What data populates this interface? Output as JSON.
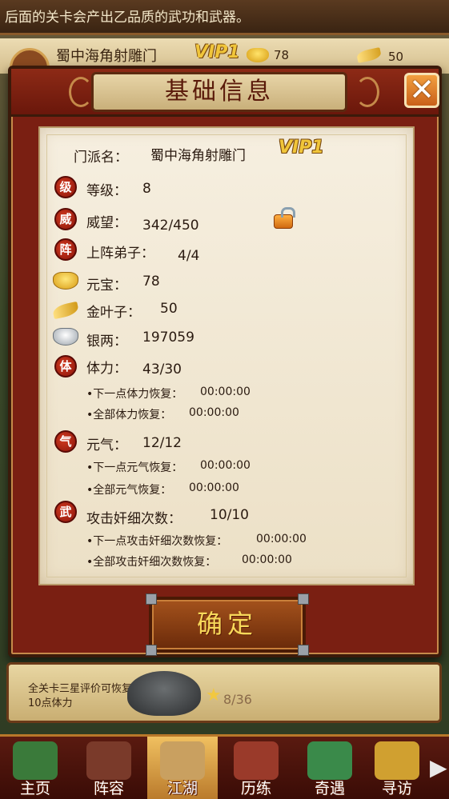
{
  "top_banner": {
    "text": "后面的关卡会产出乙品质的武功和武器。"
  },
  "player_bar": {
    "name": "蜀中海角射雕门",
    "vip": "VIP1",
    "gold": "78",
    "leaf": "50"
  },
  "dialog": {
    "title": "基础信息",
    "close_icon": "close-icon",
    "sect_label": "门派名：",
    "sect_name": "蜀中海角射雕门",
    "vip": "VIP1",
    "rows": {
      "level": {
        "badge": "级",
        "label": "等级：",
        "value": "8"
      },
      "prestige": {
        "badge": "威",
        "label": "威望：",
        "value": "342/450"
      },
      "disciples": {
        "badge": "阵",
        "label": "上阵弟子：",
        "value": "4/4"
      },
      "yuanbao": {
        "label": "元宝：",
        "value": "78"
      },
      "golden_leaf": {
        "label": "金叶子：",
        "value": "50"
      },
      "silver": {
        "label": "银两：",
        "value": "197059"
      },
      "stamina": {
        "badge": "体",
        "label": "体力：",
        "value": "43/30",
        "next_label": "•下一点体力恢复：",
        "next_value": "00:00:00",
        "all_label": "•全部体力恢复：",
        "all_value": "00:00:00"
      },
      "qi": {
        "badge": "气",
        "label": "元气：",
        "value": "12/12",
        "next_label": "•下一点元气恢复：",
        "next_value": "00:00:00",
        "all_label": "•全部元气恢复：",
        "all_value": "00:00:00"
      },
      "spy": {
        "badge": "武",
        "label": "攻击奸细次数：",
        "value": "10/10",
        "next_label": "•下一点攻击奸细次数恢复：",
        "next_value": "00:00:00",
        "all_label": "•全部攻击奸细次数恢复：",
        "all_value": "00:00:00"
      }
    },
    "confirm": "确定"
  },
  "stage": {
    "text": "全关卡三星评价可恢复10点体力",
    "count": "8/36"
  },
  "nav": {
    "items": [
      {
        "label": "主页",
        "icon": "house-icon",
        "color": "#3a7a3a"
      },
      {
        "label": "阵容",
        "icon": "warrior-icon",
        "color": "#7a3a2a"
      },
      {
        "label": "江湖",
        "icon": "sword-icon",
        "color": "#c9a060"
      },
      {
        "label": "历练",
        "icon": "scroll-icon",
        "color": "#9a3a2a"
      },
      {
        "label": "奇遇",
        "icon": "mountain-icon",
        "color": "#3a8a4a"
      },
      {
        "label": "寻访",
        "icon": "treasure-icon",
        "color": "#d0a030"
      }
    ],
    "more": "▶"
  }
}
